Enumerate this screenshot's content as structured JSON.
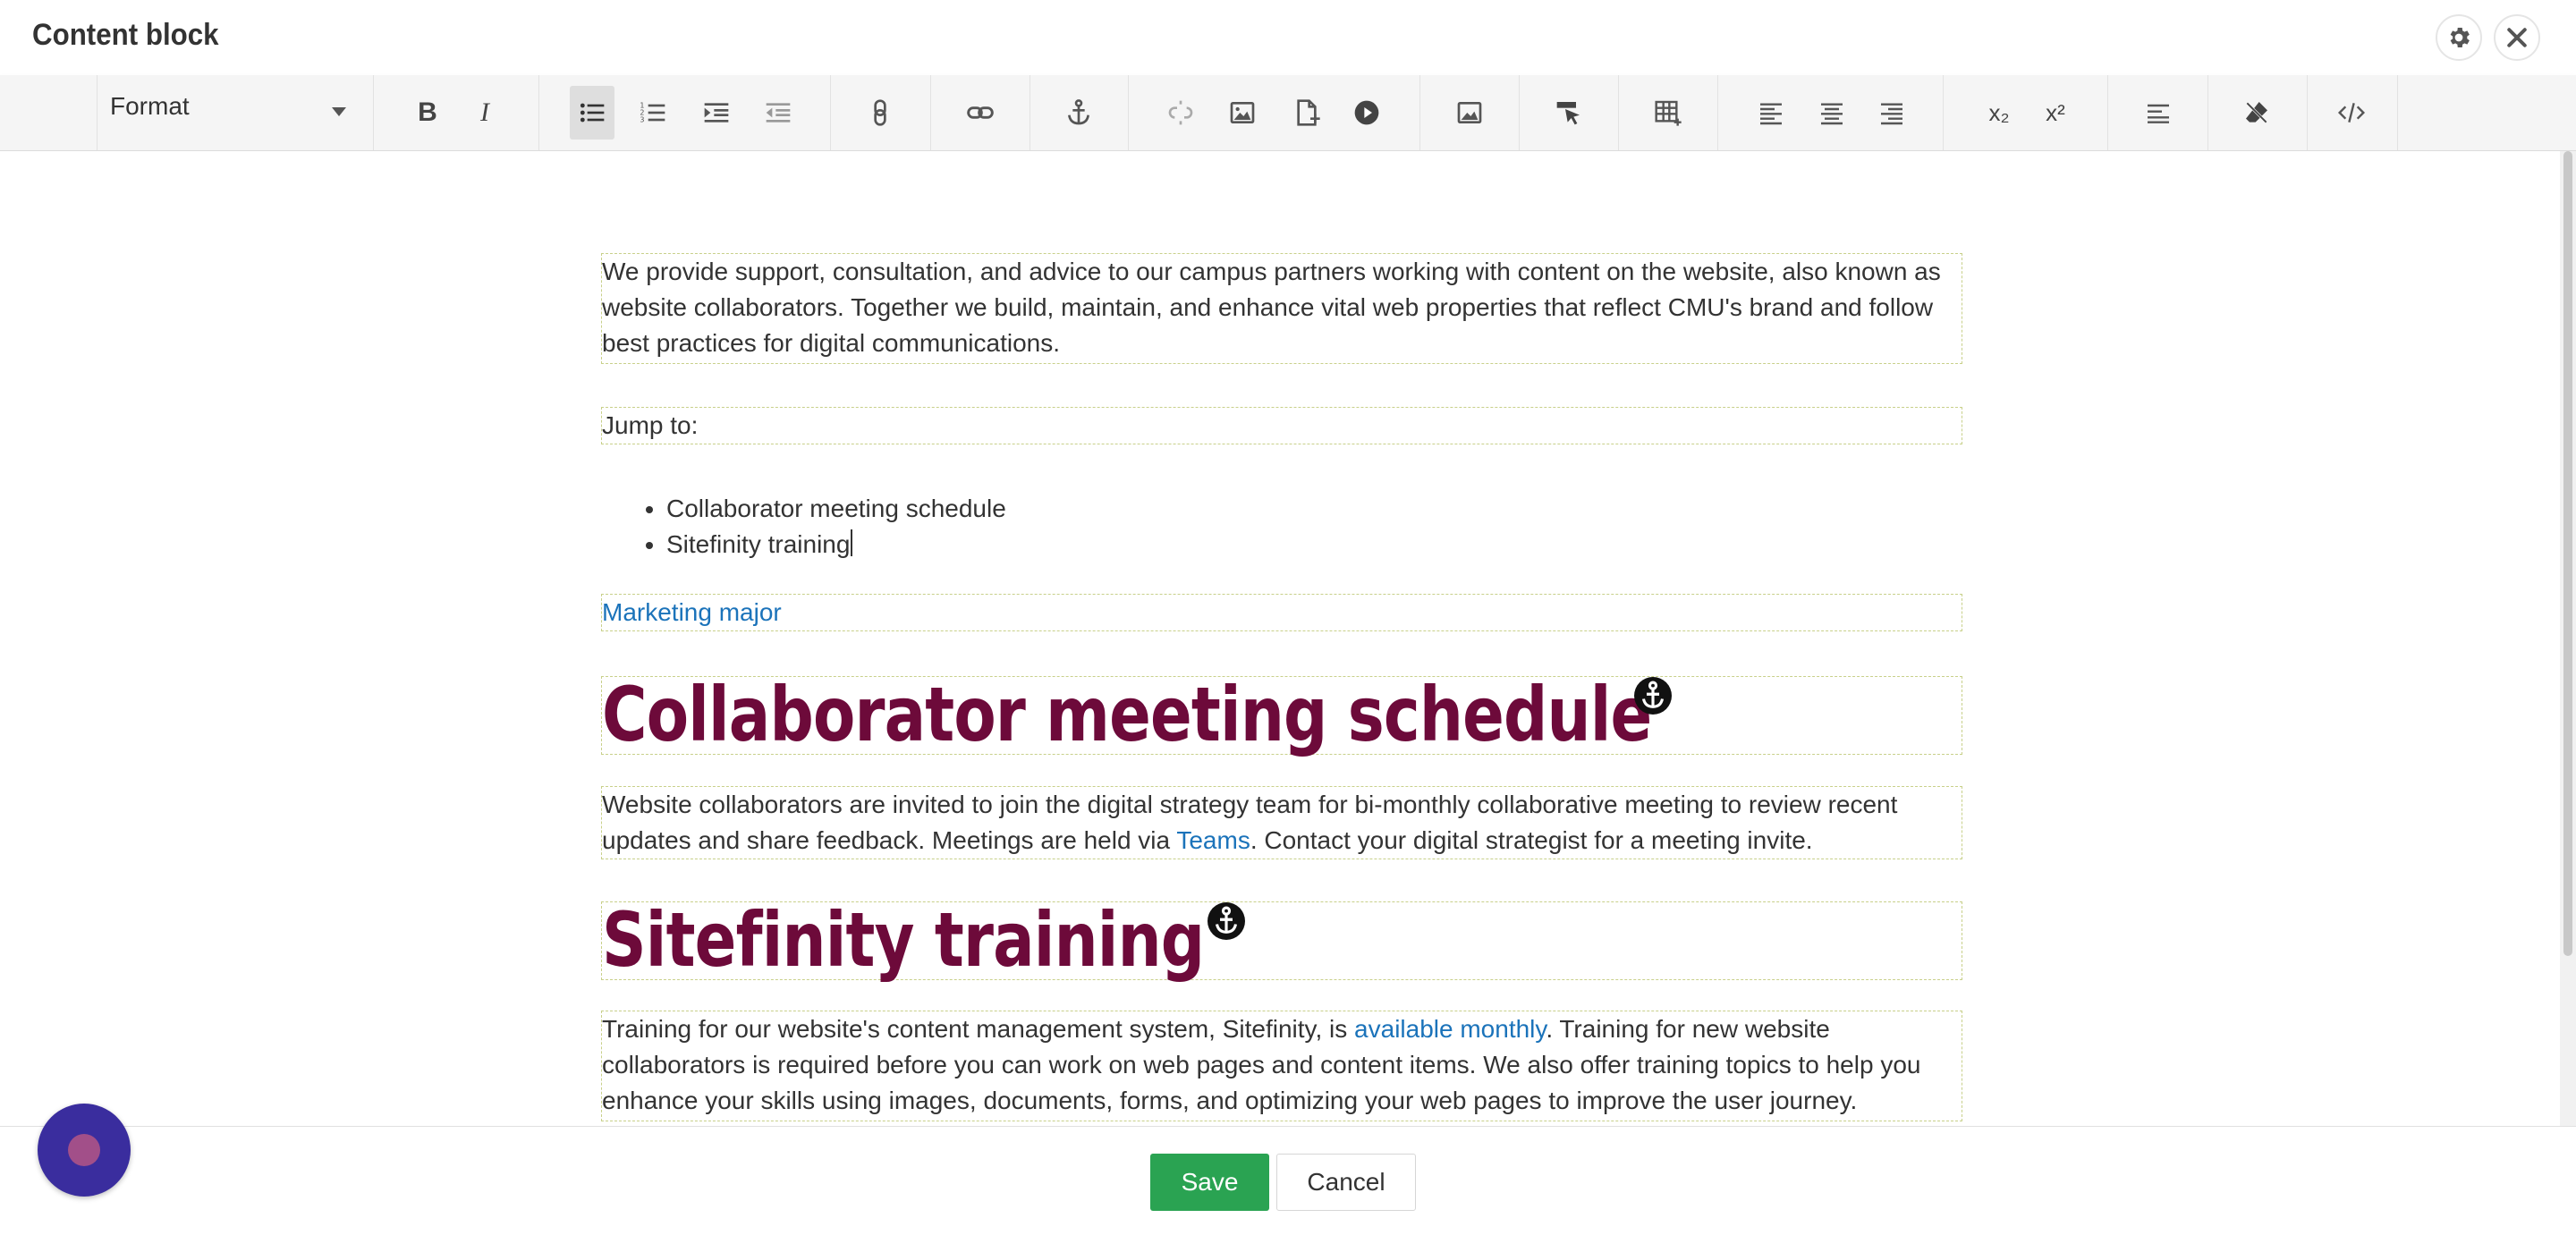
{
  "header": {
    "title": "Content block",
    "icons": {
      "settings": "gear-icon",
      "close": "close-icon"
    }
  },
  "toolbar": {
    "format_label": "Format",
    "buttons": [
      "bold",
      "italic",
      "bulleted-list",
      "numbered-list",
      "outdent",
      "indent",
      "paragraph-link",
      "insert-link",
      "anchor",
      "unlink",
      "insert-image",
      "insert-document",
      "insert-video",
      "image-gallery",
      "paste-format",
      "insert-table",
      "align-left",
      "align-center",
      "align-right",
      "subscript",
      "superscript",
      "paragraph-style",
      "clear-formatting",
      "source-code"
    ],
    "bold_label": "B",
    "italic_label": "I",
    "subscript_label": "x₂",
    "superscript_label": "x²"
  },
  "content": {
    "intro": "We provide support, consultation, and advice to our campus partners working with content on the website, also known as website collaborators. Together we build, maintain, and enhance vital web properties that reflect CMU's brand and follow best practices for digital communications.",
    "jump_label": "Jump to:",
    "jump_items": [
      "Collaborator meeting schedule",
      "Sitefinity training"
    ],
    "marketing_link": "Marketing major",
    "heading1": "Collaborator meeting schedule",
    "para1_before": "Website collaborators are invited to join the digital strategy team for bi-monthly collaborative meeting to review recent updates and share feedback. Meetings are held via ",
    "para1_link": "Teams",
    "para1_after": ". Contact your digital strategist for a meeting invite.",
    "heading2": "Sitefinity training",
    "para2_before": "Training for our website's content management system, Sitefinity, is ",
    "para2_link": "available monthly",
    "para2_after": ". Training for new website collaborators is required before you can work on web pages and content items. We also offer training topics to help you enhance your skills using images, documents, forms, and optimizing your web pages to improve the user journey."
  },
  "footer": {
    "save_label": "Save",
    "cancel_label": "Cancel"
  },
  "colors": {
    "heading": "#6d0a3a",
    "link": "#1b73ba",
    "save": "#2aa352",
    "chat": "#3a2d9e"
  }
}
